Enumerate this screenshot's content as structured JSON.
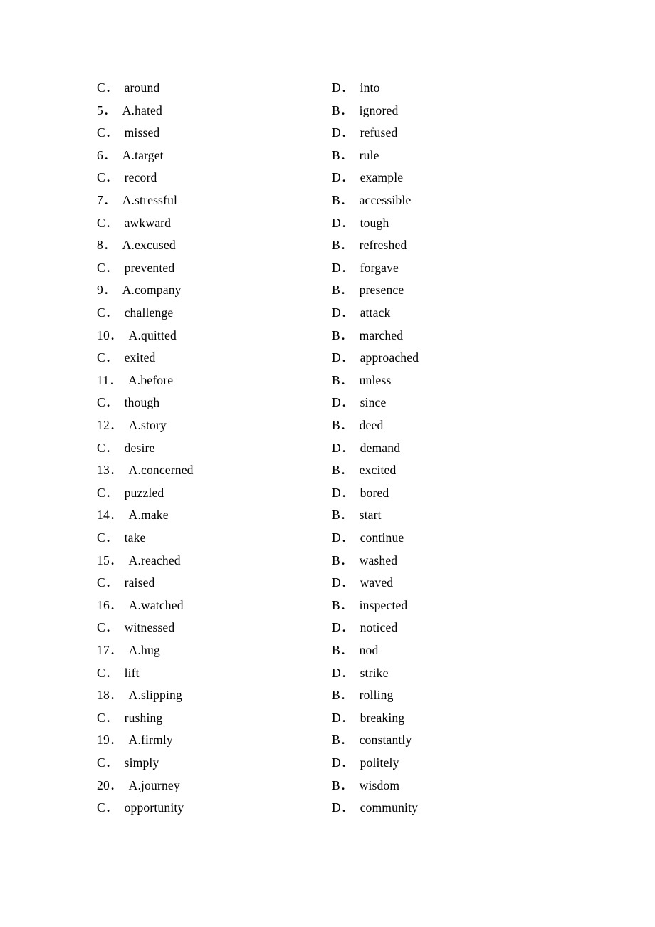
{
  "document": {
    "type": "exam-answer-options",
    "page_background": "#ffffff",
    "text_color": "#000000",
    "columns": 2,
    "rows": [
      {
        "left_label": "C．",
        "left_value": "around",
        "right_label": "D．",
        "right_value": "into"
      },
      {
        "left_label": "5．",
        "left_value": "A.hated",
        "right_label": "B．",
        "right_value": "ignored"
      },
      {
        "left_label": "C．",
        "left_value": "missed",
        "right_label": "D．",
        "right_value": "refused"
      },
      {
        "left_label": "6．",
        "left_value": "A.target",
        "right_label": "B．",
        "right_value": "rule"
      },
      {
        "left_label": "C．",
        "left_value": "record",
        "right_label": "D．",
        "right_value": "example"
      },
      {
        "left_label": "7．",
        "left_value": "A.stressful",
        "right_label": "B．",
        "right_value": "accessible"
      },
      {
        "left_label": "C．",
        "left_value": "awkward",
        "right_label": "D．",
        "right_value": "tough"
      },
      {
        "left_label": "8．",
        "left_value": "A.excused",
        "right_label": "B．",
        "right_value": "refreshed"
      },
      {
        "left_label": "C．",
        "left_value": "prevented",
        "right_label": "D．",
        "right_value": "forgave"
      },
      {
        "left_label": "9．",
        "left_value": "A.company",
        "right_label": "B．",
        "right_value": "presence"
      },
      {
        "left_label": "C．",
        "left_value": "challenge",
        "right_label": "D．",
        "right_value": "attack"
      },
      {
        "left_label": "10．",
        "left_value": "A.quitted",
        "right_label": "B．",
        "right_value": "marched"
      },
      {
        "left_label": "C．",
        "left_value": "exited",
        "right_label": "D．",
        "right_value": "approached"
      },
      {
        "left_label": "11．",
        "left_value": "A.before",
        "right_label": "B．",
        "right_value": "unless"
      },
      {
        "left_label": "C．",
        "left_value": "though",
        "right_label": "D．",
        "right_value": "since"
      },
      {
        "left_label": "12．",
        "left_value": "A.story",
        "right_label": "B．",
        "right_value": "deed"
      },
      {
        "left_label": "C．",
        "left_value": "desire",
        "right_label": "D．",
        "right_value": "demand"
      },
      {
        "left_label": "13．",
        "left_value": "A.concerned",
        "right_label": "B．",
        "right_value": "excited"
      },
      {
        "left_label": "C．",
        "left_value": "puzzled",
        "right_label": "D．",
        "right_value": "bored"
      },
      {
        "left_label": "14．",
        "left_value": "A.make",
        "right_label": "B．",
        "right_value": "start"
      },
      {
        "left_label": "C．",
        "left_value": "take",
        "right_label": "D．",
        "right_value": "continue"
      },
      {
        "left_label": "15．",
        "left_value": "A.reached",
        "right_label": "B．",
        "right_value": "washed"
      },
      {
        "left_label": "C．",
        "left_value": "raised",
        "right_label": "D．",
        "right_value": "waved"
      },
      {
        "left_label": "16．",
        "left_value": "A.watched",
        "right_label": "B．",
        "right_value": "inspected"
      },
      {
        "left_label": "C．",
        "left_value": "witnessed",
        "right_label": "D．",
        "right_value": "noticed"
      },
      {
        "left_label": "17．",
        "left_value": "A.hug",
        "right_label": "B．",
        "right_value": "nod"
      },
      {
        "left_label": "C．",
        "left_value": "lift",
        "right_label": "D．",
        "right_value": "strike"
      },
      {
        "left_label": "18．",
        "left_value": "A.slipping",
        "right_label": "B．",
        "right_value": "rolling"
      },
      {
        "left_label": "C．",
        "left_value": "rushing",
        "right_label": "D．",
        "right_value": "breaking"
      },
      {
        "left_label": "19．",
        "left_value": "A.firmly",
        "right_label": "B．",
        "right_value": "constantly"
      },
      {
        "left_label": "C．",
        "left_value": "simply",
        "right_label": "D．",
        "right_value": "politely"
      },
      {
        "left_label": "20．",
        "left_value": "A.journey",
        "right_label": "B．",
        "right_value": "wisdom"
      },
      {
        "left_label": "C．",
        "left_value": "opportunity",
        "right_label": "D．",
        "right_value": "community"
      }
    ]
  }
}
